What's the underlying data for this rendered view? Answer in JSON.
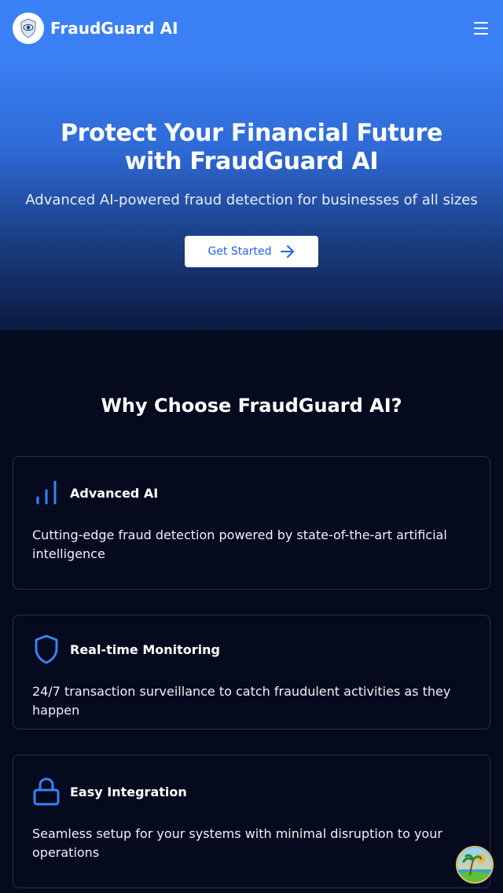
{
  "header": {
    "brand_name": "FraudGuard AI",
    "logo_icon": "shield-eye-icon",
    "menu_icon": "hamburger-menu-icon"
  },
  "hero": {
    "title": "Protect Your Financial Future with FraudGuard AI",
    "subtitle": "Advanced AI-powered fraud detection for businesses of all sizes",
    "cta_label": "Get Started",
    "cta_icon": "arrow-right-icon"
  },
  "features": {
    "title": "Why Choose FraudGuard AI?",
    "items": [
      {
        "title": "Advanced AI",
        "icon": "signal-bars-icon",
        "description": "Cutting-edge fraud detection powered by state-of-the-art artificial intelligence"
      },
      {
        "title": "Real-time Monitoring",
        "icon": "shield-icon",
        "description": "24/7 transaction surveillance to catch fraudulent activities as they happen"
      },
      {
        "title": "Easy Integration",
        "icon": "lock-icon",
        "description": "Seamless setup for your systems with minimal disruption to your operations"
      }
    ]
  },
  "colors": {
    "accent": "#3b82f6",
    "background": "#050a1e",
    "card_border": "#2a3147"
  }
}
